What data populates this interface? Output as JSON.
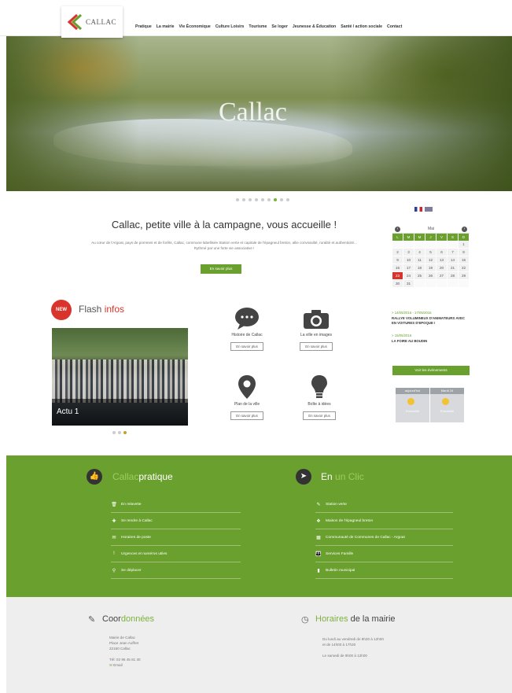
{
  "logo": {
    "text": "CALLAC"
  },
  "nav": [
    "Pratique",
    "La mairie",
    "Vie Économique",
    "Culture Loisirs",
    "Tourisme",
    "Se loger",
    "Jeunesse & Éducation",
    "Santé / action sociale",
    "Contact"
  ],
  "hero": {
    "title": "Callac"
  },
  "intro": {
    "title": "Callac, petite ville à la campagne, vous accueille !",
    "text": "Au cœur de l'Argoat, pays de pommes et de forêts, Callac, commune labellisée Station verte et capitale de l'épagneul breton, allie convivialité, ruralité et authenticité... Rythmé par une forte vie associative !",
    "button": "En savoir plus"
  },
  "calendar": {
    "month": "Mai",
    "days": [
      "L",
      "M",
      "M",
      "J",
      "V",
      "S",
      "D"
    ],
    "cells": [
      "",
      "",
      "",
      "",
      "",
      "",
      "1",
      "2",
      "3",
      "4",
      "5",
      "6",
      "7",
      "8",
      "9",
      "10",
      "11",
      "12",
      "13",
      "14",
      "15",
      "16",
      "17",
      "18",
      "19",
      "20",
      "21",
      "22",
      "23",
      "24",
      "25",
      "26",
      "27",
      "28",
      "29",
      "30",
      "31",
      "",
      "",
      "",
      "",
      ""
    ],
    "today": "23"
  },
  "agenda": [
    {
      "date": "> 14/05/2016 - 17/05/2016",
      "title": "RALLYE VOLUMINEUX D'ANIMATEURS AVEC EN VOITURES D'EPOQUE !"
    },
    {
      "date": "> 15/05/2016",
      "title": "LA FOIRE AU BOUDIN"
    }
  ],
  "agenda_button": "Voir les événements",
  "weather": [
    {
      "day": "aujourd'hui",
      "text": "Ensoleillé"
    },
    {
      "day": "Mardi 24",
      "text": "Ensoleillé"
    }
  ],
  "flash": {
    "badge": "NEW",
    "title_a": "Flash",
    "title_b": "infos",
    "caption": "Actu 1"
  },
  "tiles": [
    {
      "label": "Histoire de Callac",
      "more": "En savoir plus"
    },
    {
      "label": "La ville en images",
      "more": "En savoir plus"
    },
    {
      "label": "Plan de la ville",
      "more": "En savoir plus"
    },
    {
      "label": "Boîte à idées",
      "more": "En savoir plus"
    }
  ],
  "pratique": {
    "title_a": "Callac",
    "title_b": "pratique",
    "items": [
      "En relavette",
      "Se rendre à Callac",
      "Horaires de poste",
      "Urgences et numéros utiles",
      "Se déplacer"
    ]
  },
  "clic": {
    "title_a": "En",
    "title_b": "un",
    "title_c": "Clic",
    "items": [
      "Station verte",
      "Maison de l'épagneul breton",
      "Communauté de Communes de Callac - Argoat",
      "Services Famille",
      "Bulletin municipal"
    ]
  },
  "coord": {
    "title_a": "Coor",
    "title_b": "données",
    "lines": [
      "Mairie de Callac",
      "Place Jean Auffret",
      "22160 Callac",
      "",
      "Tél: 02 96 45 81 30",
      "Email"
    ]
  },
  "horaires": {
    "title_a": "Horaires",
    "title_b": "de la mairie",
    "lines": [
      "Du lundi au vendredi de 8h30 à 12h00",
      "et de 14h00 à 17h30",
      "",
      "Le samedi de 9h00 à 12h00"
    ]
  },
  "colors": {
    "green": "#6aa02d",
    "red": "#d9342b"
  }
}
